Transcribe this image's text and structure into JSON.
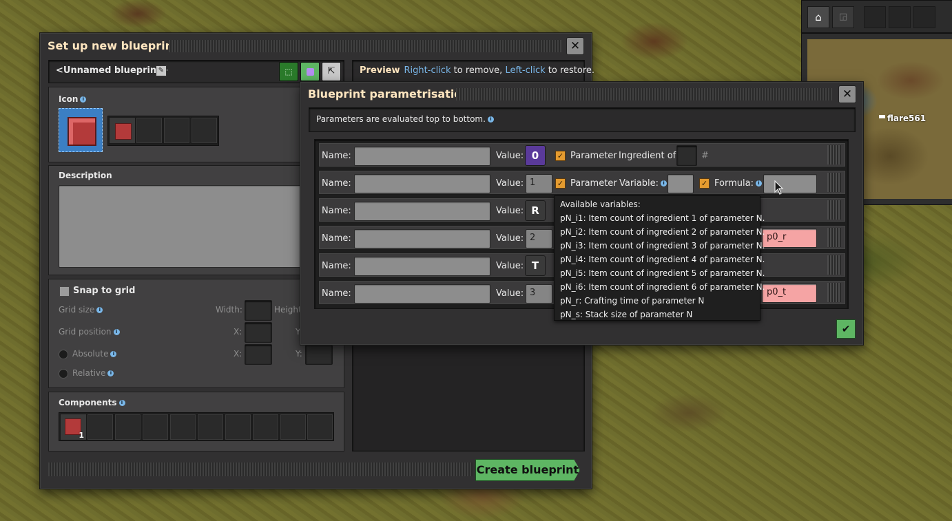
{
  "main_window": {
    "title": "Set up new blueprint",
    "blueprint_name": "<Unnamed blueprint>",
    "icon_section_label": "Icon",
    "description_label": "Description",
    "snap_to_grid_label": "Snap to grid",
    "grid_size_label": "Grid size",
    "width_label": "Width:",
    "height_label": "Height",
    "grid_position_label": "Grid position",
    "x_label": "X:",
    "y_label": "Y:",
    "absolute_label": "Absolute",
    "relative_label": "Relative",
    "components_label": "Components",
    "component_count": "1",
    "create_button": "Create blueprint",
    "preview_label": "Preview",
    "preview_hint_1": "Right-click",
    "preview_hint_2": " to remove, ",
    "preview_hint_3": "Left-click",
    "preview_hint_4": " to restore."
  },
  "param_dialog": {
    "title": "Blueprint parametrisation",
    "note": "Parameters are evaluated top to bottom.",
    "name_label": "Name:",
    "value_label": "Value:",
    "parameter_label": "Parameter",
    "ingredient_of_label": "Ingredient of:",
    "hash": "#",
    "variable_label": "Variable:",
    "formula_label": "Formula:",
    "rows": [
      {
        "value": "0"
      },
      {
        "value": "1"
      },
      {
        "value": "R"
      },
      {
        "value": "2",
        "formula": "p0_r"
      },
      {
        "value": "T"
      },
      {
        "value": "3",
        "formula": "p0_t"
      }
    ]
  },
  "tooltip": {
    "lines": [
      "Available variables:",
      "pN_i1: Item count of ingredient 1 of parameter N.",
      "pN_i2: Item count of ingredient 2 of parameter N.",
      "pN_i3: Item count of ingredient 3 of parameter N.",
      "pN_i4: Item count of ingredient 4 of parameter N.",
      "pN_i5: Item count of ingredient 5 of parameter N.",
      "pN_i6: Item count of ingredient 6 of parameter N.",
      "pN_r: Crafting time of parameter N",
      "pN_s: Stack size of parameter N"
    ]
  },
  "minimap": {
    "player_label": "flare561"
  },
  "colors": {
    "accent_orange": "#e59b2f",
    "confirm_green": "#5eb663",
    "link_blue": "#7ab7e8",
    "formula_pink": "#f5a4a4",
    "title_cream": "#ffe6c0"
  }
}
